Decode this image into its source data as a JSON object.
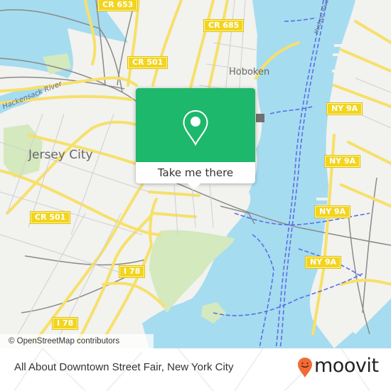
{
  "map": {
    "road_labels": [
      {
        "id": "cr653",
        "text": "CR 653"
      },
      {
        "id": "cr685",
        "text": "CR 685"
      },
      {
        "id": "cr501-north",
        "text": "CR 501"
      },
      {
        "id": "cr501-west",
        "text": "CR 501"
      },
      {
        "id": "ny9a-1",
        "text": "NY 9A"
      },
      {
        "id": "ny9a-2",
        "text": "NY 9A"
      },
      {
        "id": "ny9a-3",
        "text": "NY 9A"
      },
      {
        "id": "ny9a-4",
        "text": "NY 9A"
      },
      {
        "id": "i78-1",
        "text": "I 78"
      },
      {
        "id": "i78-2",
        "text": "I 78"
      }
    ],
    "place_labels": {
      "jersey_city": "Jersey City",
      "hoboken": "Hoboken"
    },
    "water_labels": {
      "hackensack": "Hackensack River",
      "hudson": "Hudson River"
    },
    "colors": {
      "water": "#a6dcef",
      "land": "#f2f2ef",
      "park": "#d4e9be",
      "road_major": "#f7e06a",
      "ferry": "#5a6ee8",
      "rail": "#808080"
    },
    "attribution": "© OpenStreetMap contributors"
  },
  "popup": {
    "icon": "location-pin-icon",
    "cta_label": "Take me there",
    "accent": "#1db86b"
  },
  "footer": {
    "title": "All About Downtown Street Fair, New York City",
    "brand": "moovit",
    "brand_color": "#f26a36"
  }
}
